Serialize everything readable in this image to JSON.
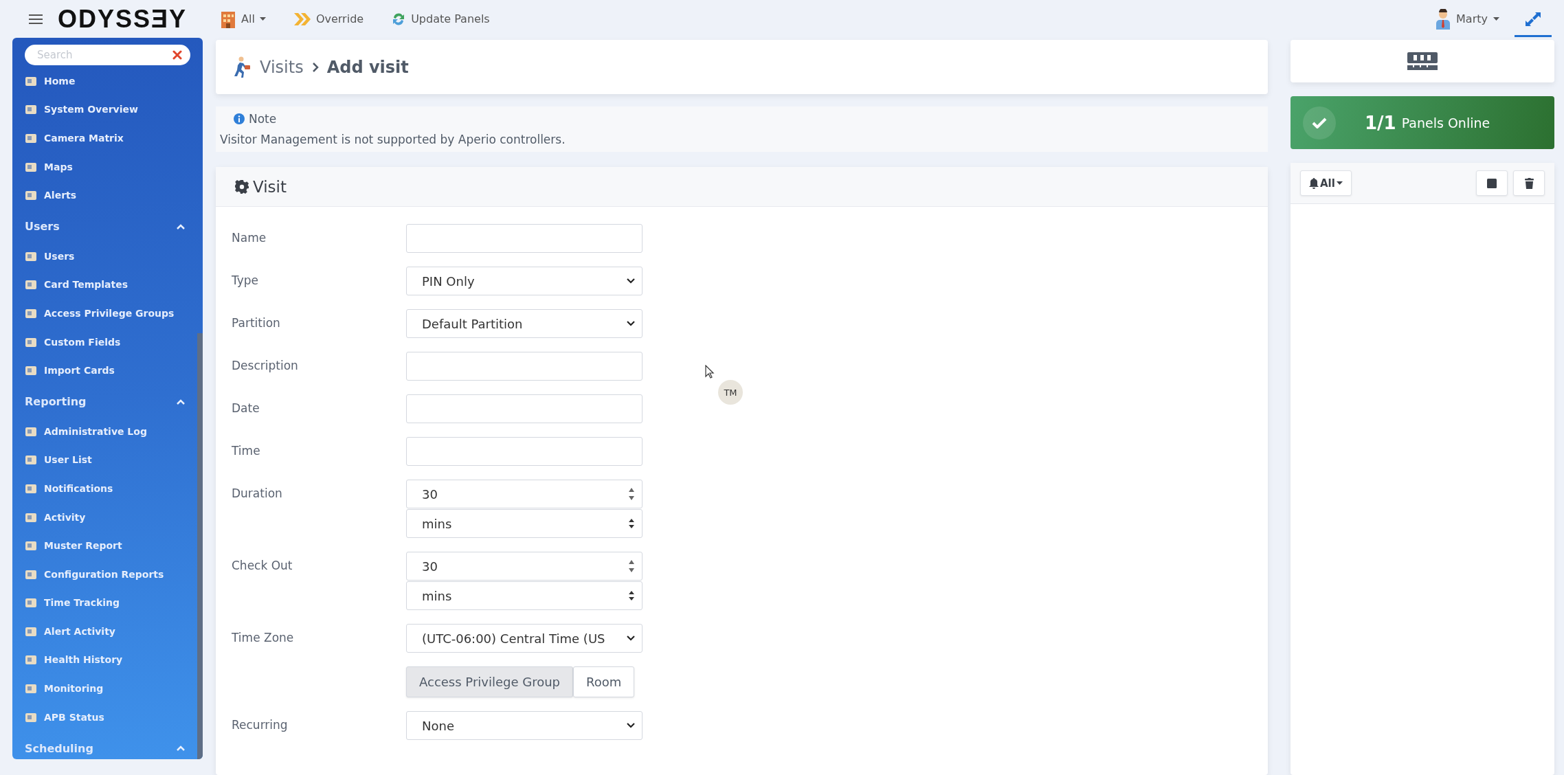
{
  "topbar": {
    "logo": "ODYSSƎY",
    "nav": [
      {
        "kind": "building",
        "label": "All",
        "dropdown": true
      },
      {
        "kind": "override",
        "label": "Override",
        "dropdown": false
      },
      {
        "kind": "refresh",
        "label": "Update Panels",
        "dropdown": false
      }
    ],
    "user": {
      "name": "Marty",
      "dropdown": true
    },
    "fullscreen": {
      "selected": true
    }
  },
  "sidebar": {
    "search": {
      "placeholder": "Search"
    },
    "items": [
      {
        "label": "Home"
      },
      {
        "label": "System Overview"
      },
      {
        "label": "Camera Matrix"
      },
      {
        "label": "Maps"
      },
      {
        "label": "Alerts"
      }
    ],
    "sections": [
      {
        "title": "Users",
        "expanded": true,
        "items": [
          {
            "label": "Users"
          },
          {
            "label": "Card Templates"
          },
          {
            "label": "Access Privilege Groups"
          },
          {
            "label": "Custom Fields"
          },
          {
            "label": "Import Cards"
          }
        ]
      },
      {
        "title": "Reporting",
        "expanded": true,
        "items": [
          {
            "label": "Administrative Log"
          },
          {
            "label": "User List"
          },
          {
            "label": "Notifications"
          },
          {
            "label": "Activity"
          },
          {
            "label": "Muster Report"
          },
          {
            "label": "Configuration Reports"
          },
          {
            "label": "Time Tracking"
          },
          {
            "label": "Alert Activity"
          },
          {
            "label": "Health History"
          },
          {
            "label": "Monitoring"
          },
          {
            "label": "APB Status"
          }
        ]
      },
      {
        "title": "Scheduling",
        "expanded": true
      }
    ]
  },
  "breadcrumb": [
    "Visits",
    "Add visit"
  ],
  "note": {
    "title": "Note",
    "text": "Visitor Management is not supported by Aperio controllers."
  },
  "visit": {
    "title": "Visit",
    "fields": [
      {
        "kind": "text",
        "label": "Name"
      },
      {
        "kind": "select",
        "label": "Type",
        "value": "PIN Only"
      },
      {
        "kind": "select",
        "label": "Partition",
        "value": "Default Partition"
      },
      {
        "kind": "text",
        "label": "Description"
      },
      {
        "kind": "text",
        "label": "Date"
      },
      {
        "kind": "text",
        "label": "Time"
      },
      {
        "kind": "number_unit",
        "label": "Duration",
        "value": "30",
        "unit": "mins"
      },
      {
        "kind": "number_unit",
        "label": "Check Out",
        "value": "30",
        "unit": "mins"
      },
      {
        "kind": "select",
        "label": "Time Zone",
        "value": "(UTC-06:00) Central Time (US"
      },
      {
        "kind": "toggle",
        "options": [
          {
            "label": "Access Privilege Group",
            "selected": true
          },
          {
            "label": "Room",
            "selected": false
          }
        ]
      },
      {
        "kind": "select",
        "label": "Recurring",
        "value": "None"
      }
    ]
  },
  "cursor_badge": "TM",
  "panels_status": {
    "count": "1/1",
    "label": "Panels Online",
    "online": true
  },
  "alerts_panel": {
    "filter": "All"
  }
}
